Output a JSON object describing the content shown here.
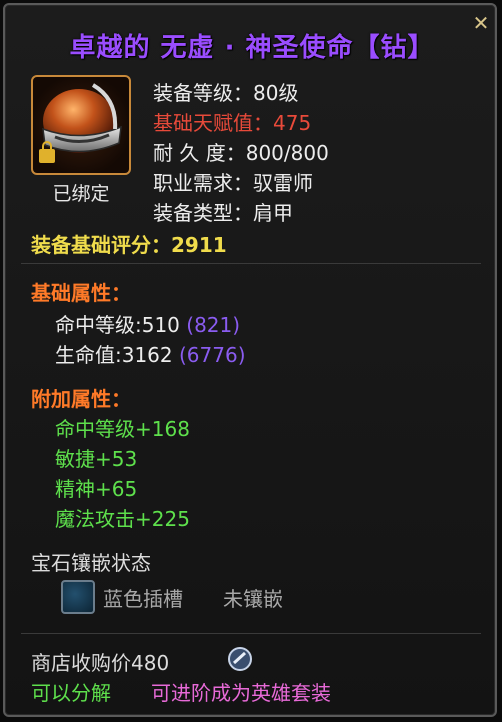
{
  "item": {
    "title": "卓越的 无虚 · 神圣使命【钻】",
    "bound": "已绑定",
    "icon": "helmet-item-icon",
    "stats": {
      "level": "装备等级：80级",
      "base_talent_label": "基础天赋值：",
      "base_talent_value": "475",
      "durability": "耐 久 度：800/800",
      "class_req": "职业需求：驭雷师",
      "equip_type": "装备类型：肩甲"
    },
    "score_label": "装备基础评分：",
    "score_value": "2911"
  },
  "base_attrs": {
    "header": "基础属性：",
    "items": [
      {
        "label": "命中等级:510",
        "extra": "(821)"
      },
      {
        "label": "生命值:3162",
        "extra": "(6776)"
      }
    ]
  },
  "bonus_attrs": {
    "header": "附加属性：",
    "items": [
      "命中等级+168",
      "敏捷+53",
      "精神+65",
      "魔法攻击+225"
    ]
  },
  "gem": {
    "header": "宝石镶嵌状态",
    "slot_label": "蓝色插槽",
    "slot_status": "未镶嵌"
  },
  "footer": {
    "shop_price": "商店收购价480",
    "decomposable": "可以分解",
    "upgrade": "可进阶成为英雄套装"
  },
  "colors": {
    "title": "#9a4dff",
    "red_stat": "#e84a3a",
    "orange_header": "#ff7a28",
    "green": "#5ee04c",
    "purple": "#8a5cf0",
    "yellow": "#f0dc4c"
  }
}
